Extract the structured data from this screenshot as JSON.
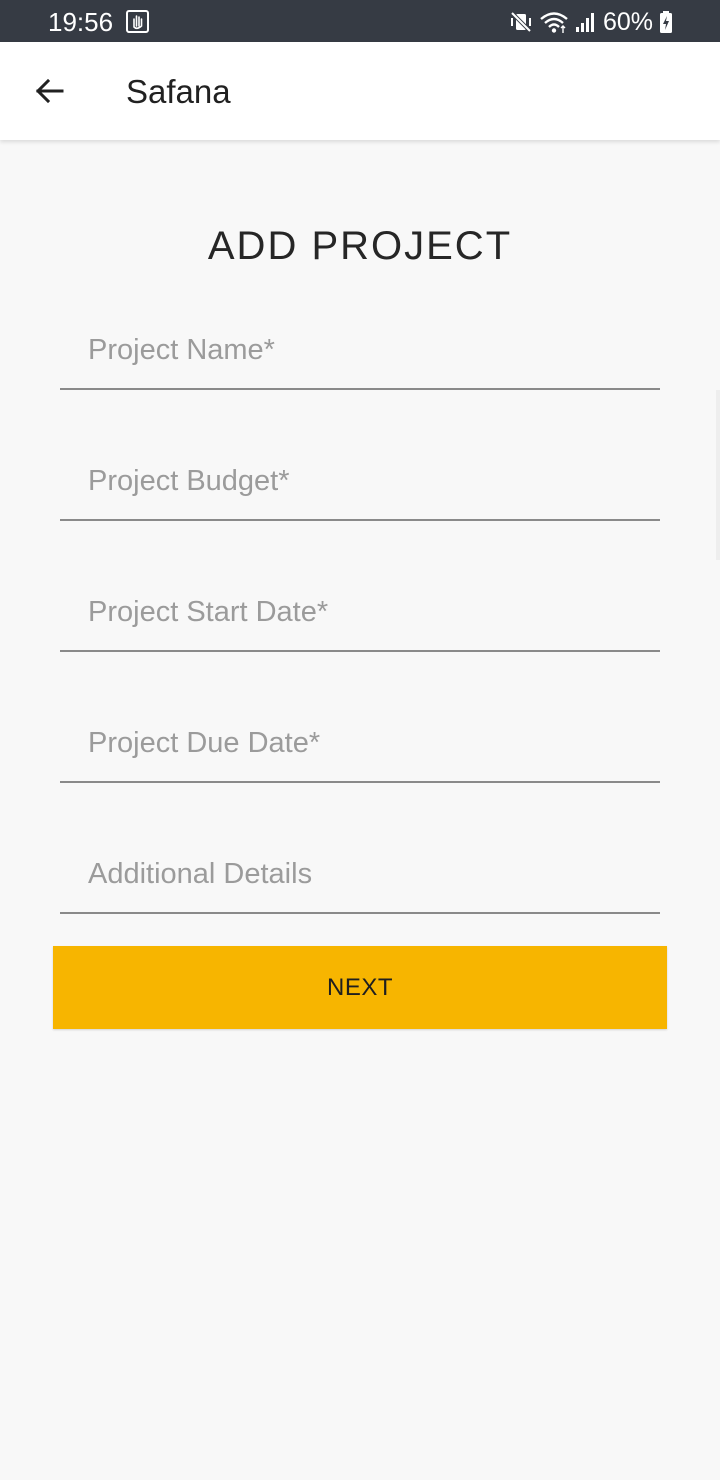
{
  "status_bar": {
    "time": "19:56",
    "battery_percent": "60%",
    "icons": [
      "hand-gesture-icon",
      "mute-vibrate-icon",
      "wifi-icon",
      "signal-icon",
      "battery-charging-icon"
    ]
  },
  "app_bar": {
    "title": "Safana",
    "back_icon": "arrow-left-icon"
  },
  "form": {
    "heading": "ADD PROJECT",
    "fields": [
      {
        "name": "project-name",
        "placeholder": "Project Name*",
        "value": ""
      },
      {
        "name": "project-budget",
        "placeholder": "Project Budget*",
        "value": ""
      },
      {
        "name": "project-start-date",
        "placeholder": "Project Start Date*",
        "value": ""
      },
      {
        "name": "project-due-date",
        "placeholder": "Project Due Date*",
        "value": ""
      },
      {
        "name": "additional-details",
        "placeholder": "Additional Details",
        "value": ""
      }
    ],
    "next_label": "NEXT"
  },
  "colors": {
    "status_bar_bg": "#363b44",
    "app_bar_bg": "#ffffff",
    "page_bg": "#f8f8f8",
    "accent": "#f7b500"
  }
}
